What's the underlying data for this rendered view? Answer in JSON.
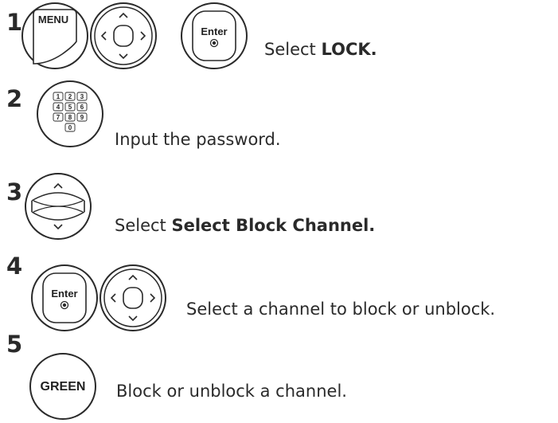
{
  "steps": [
    {
      "number": "1",
      "text_plain": "Select ",
      "text_bold": "LOCK.",
      "buttons": [
        "MENU",
        "Enter"
      ]
    },
    {
      "number": "2",
      "text_plain": "Input the password.",
      "text_bold": "",
      "buttons": [
        "1",
        "2",
        "3",
        "4",
        "5",
        "6",
        "7",
        "8",
        "9",
        "0"
      ]
    },
    {
      "number": "3",
      "text_plain": "Select ",
      "text_bold": "Select Block Channel.",
      "buttons": []
    },
    {
      "number": "4",
      "text_plain": "Select a channel to block or unblock.",
      "text_bold": "",
      "buttons": [
        "Enter"
      ]
    },
    {
      "number": "5",
      "text_plain": "Block or unblock a channel.",
      "text_bold": "",
      "buttons": [
        "GREEN"
      ]
    }
  ],
  "icons": {
    "menu": "menu-button-icon",
    "navigation": "navigation-pad-icon",
    "enter": "enter-button-icon",
    "numeric": "numeric-keypad-icon",
    "updown": "up-down-button-icon",
    "green": "green-button-icon"
  }
}
